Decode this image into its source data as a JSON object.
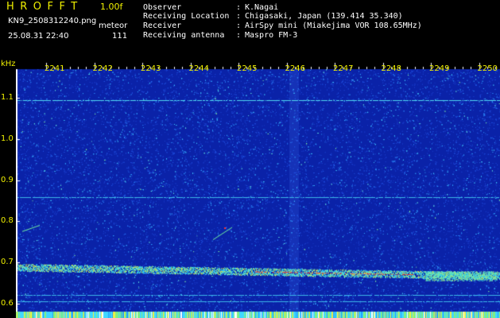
{
  "header": {
    "title": "HROFFT",
    "version": "1.00f",
    "filename": "KN9_2508312240.png",
    "mode": "meteor",
    "datetime": "25.08.31 22:40",
    "count": "111"
  },
  "meta": [
    {
      "label": "Observer",
      "sep": ":",
      "value": "K.Nagai"
    },
    {
      "label": "Receiving Location",
      "sep": ":",
      "value": "Chigasaki, Japan (139.414 35.340)"
    },
    {
      "label": "Receiver",
      "sep": ":",
      "value": "AirSpy mini (Miakejima VOR 108.65MHz)"
    },
    {
      "label": "Receiving antenna",
      "sep": ":",
      "value": "Maspro FM-3"
    }
  ],
  "chart_data": {
    "type": "heatmap",
    "ylabel": "kHz",
    "y_ticks": [
      "1.1",
      "1.0",
      "0.9",
      "0.8",
      "0.7",
      "0.6"
    ],
    "ylim": [
      0.58,
      1.17
    ],
    "x_ticks": [
      "2241",
      "2242",
      "2243",
      "2244",
      "2245",
      "2246",
      "2247",
      "2248",
      "2249",
      "2250"
    ],
    "carrier_lines_khz": [
      1.095,
      0.858,
      0.62,
      0.605
    ],
    "main_trace_khz": [
      0.688,
      0.667
    ],
    "colors": {
      "background": "#0a22a8",
      "noise": "#30c8ff",
      "hot": "#ff3030",
      "axis": "#ffffff"
    }
  }
}
